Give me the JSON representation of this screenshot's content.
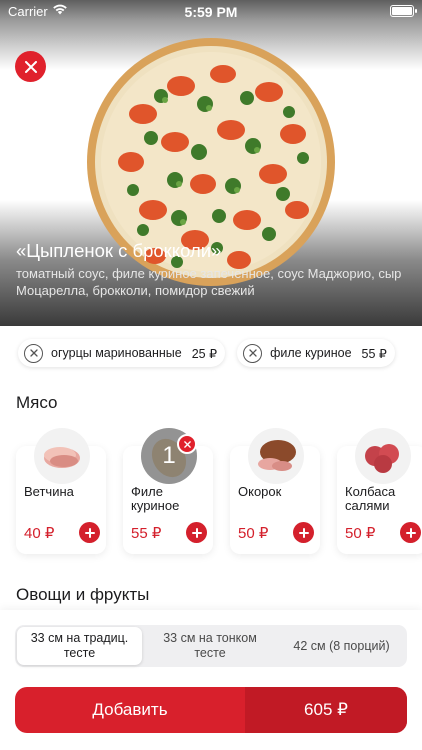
{
  "status_bar": {
    "carrier": "Carrier",
    "time": "5:59 PM"
  },
  "product": {
    "title": "«Цыпленок с брокколи»",
    "description": "томатный соус, филе куриное запечённое, соус Маджорио, сыр Моцарелла, брокколи, помидор свежий"
  },
  "selected_ingredients": [
    {
      "name": "огурцы маринованные",
      "price": "25 ₽"
    },
    {
      "name": "филе куриное",
      "price": "55 ₽"
    }
  ],
  "sections": {
    "meat": "Мясо",
    "vegetables": "Овощи и фрукты"
  },
  "meat_items": [
    {
      "name": "Ветчина",
      "price": "40 ₽"
    },
    {
      "name": "Филе куриное",
      "price": "55 ₽",
      "quantity": "1"
    },
    {
      "name": "Окорок",
      "price": "50 ₽"
    },
    {
      "name": "Колбаса салями",
      "price": "50 ₽"
    }
  ],
  "sizes": [
    {
      "label": "33 см на традиц. тесте",
      "active": true
    },
    {
      "label": "33 см на тонком тесте",
      "active": false
    },
    {
      "label": "42 см (8 порций)",
      "active": false
    }
  ],
  "add_button": {
    "label": "Добавить",
    "total": "605 ₽"
  },
  "colors": {
    "accent": "#d8202c",
    "accent_dark": "#c11a25"
  },
  "icons": [
    "wifi-icon",
    "battery-icon",
    "close-icon",
    "pizza-image",
    "remove-icon",
    "plus-icon"
  ]
}
